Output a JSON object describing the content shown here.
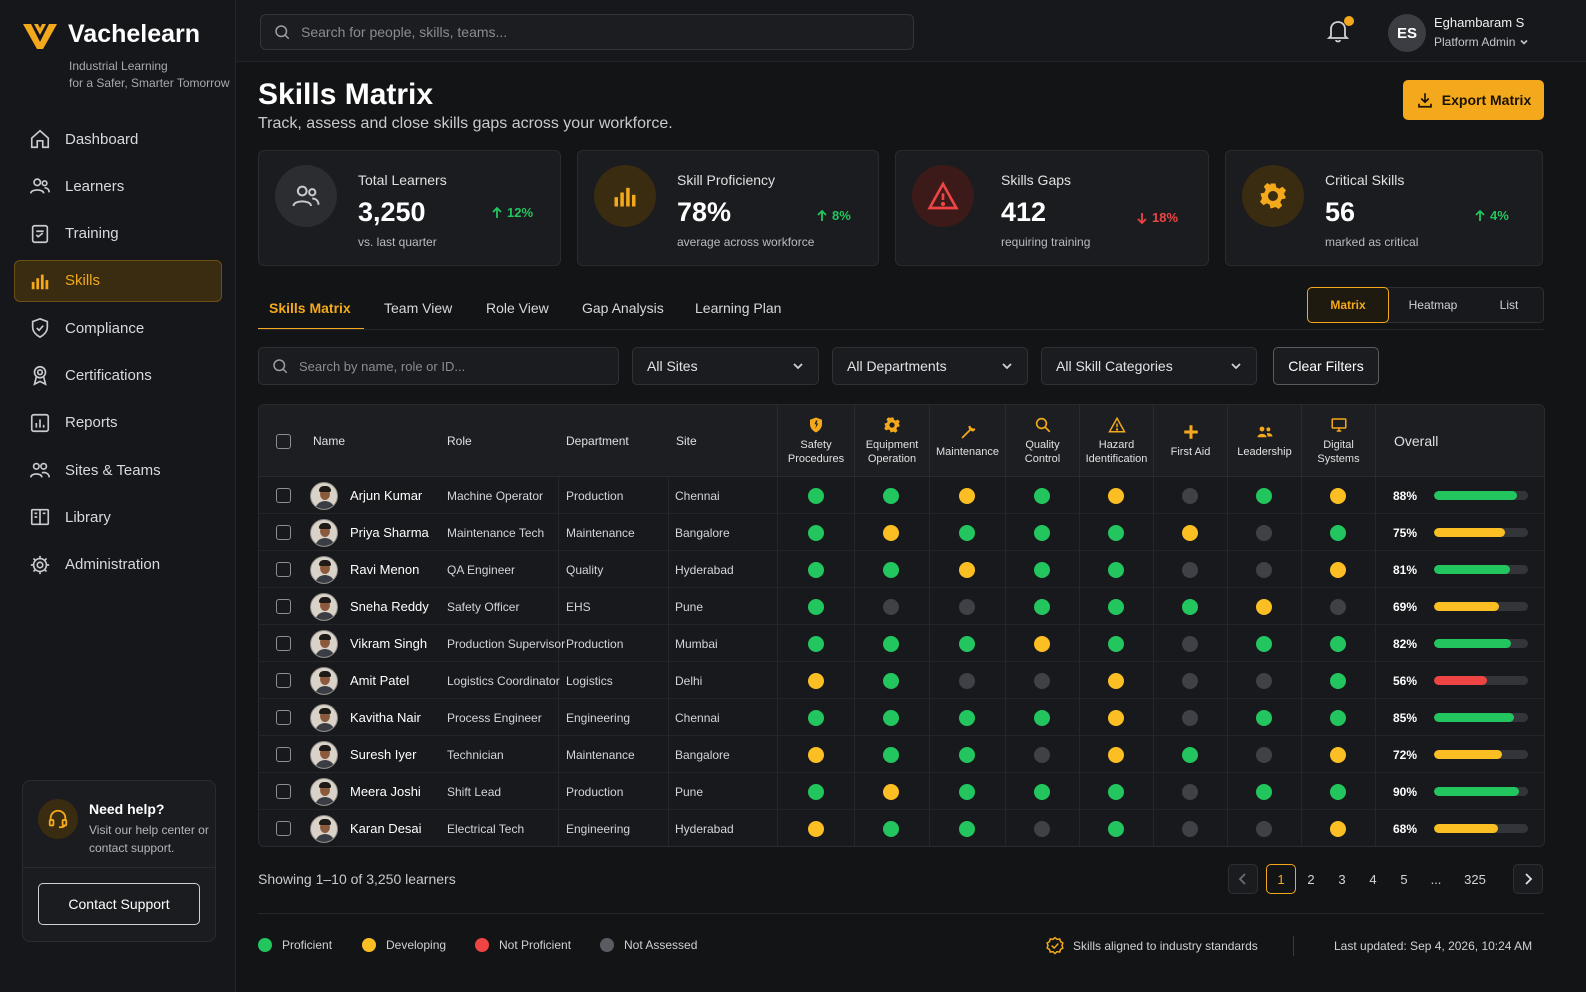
{
  "brand": {
    "name": "Vachelearn",
    "tagline_1": "Industrial Learning",
    "tagline_2": "for a Safer, Smarter Tomorrow",
    "accent": "#f3a91b"
  },
  "nav": [
    {
      "label": "Dashboard",
      "icon": "home-icon"
    },
    {
      "label": "Learners",
      "icon": "users-icon"
    },
    {
      "label": "Training",
      "icon": "clipboard-icon"
    },
    {
      "label": "Skills",
      "icon": "bar-chart-icon",
      "active": true
    },
    {
      "label": "Compliance",
      "icon": "shield-check-icon"
    },
    {
      "label": "Certifications",
      "icon": "award-icon"
    },
    {
      "label": "Reports",
      "icon": "report-icon"
    },
    {
      "label": "Sites & Teams",
      "icon": "team-icon"
    },
    {
      "label": "Library",
      "icon": "book-icon"
    },
    {
      "label": "Administration",
      "icon": "gear-icon"
    }
  ],
  "help": {
    "title": "Need help?",
    "text": "Visit our help center or contact support.",
    "button": "Contact Support"
  },
  "topbar": {
    "search_placeholder": "Search for people, skills, teams...",
    "user_initials": "ES",
    "user_name": "Eghambaram S",
    "user_role": "Platform Admin"
  },
  "page": {
    "title": "Skills Matrix",
    "subtitle": "Track, assess and close skills gaps across your workforce.",
    "export_label": "Export Matrix"
  },
  "stats": [
    {
      "label": "Total Learners",
      "value": "3,250",
      "trend": "12%",
      "direction": "up",
      "note": "vs. last quarter",
      "icon": "users-icon"
    },
    {
      "label": "Skill Proficiency",
      "value": "78%",
      "trend": "8%",
      "direction": "up",
      "note": "average across workforce",
      "icon": "bar-chart-icon"
    },
    {
      "label": "Skills Gaps",
      "value": "412",
      "trend": "18%",
      "direction": "down",
      "note": "requiring training",
      "icon": "warning-icon"
    },
    {
      "label": "Critical Skills",
      "value": "56",
      "trend": "4%",
      "direction": "up",
      "note": "marked as critical",
      "icon": "gear-icon"
    }
  ],
  "tabs": [
    "Skills Matrix",
    "Team View",
    "Role View",
    "Gap Analysis",
    "Learning Plan"
  ],
  "views": [
    "Matrix",
    "Heatmap",
    "List"
  ],
  "filters": {
    "search_placeholder": "Search by name, role or ID...",
    "sites": "All Sites",
    "departments": "All Departments",
    "categories": "All Skill Categories",
    "clear": "Clear Filters"
  },
  "table": {
    "columns": {
      "name": "Name",
      "role": "Role",
      "department": "Department",
      "site": "Site",
      "overall": "Overall"
    },
    "skills": [
      {
        "label_1": "Safety",
        "label_2": "Procedures",
        "icon": "shield-icon"
      },
      {
        "label_1": "Equipment",
        "label_2": "Operation",
        "icon": "gear-icon"
      },
      {
        "label_1": "Maintenance",
        "label_2": "",
        "icon": "wrench-icon"
      },
      {
        "label_1": "Quality",
        "label_2": "Control",
        "icon": "search-icon"
      },
      {
        "label_1": "Hazard",
        "label_2": "Identification",
        "icon": "warning-icon"
      },
      {
        "label_1": "First Aid",
        "label_2": "",
        "icon": "plus-icon"
      },
      {
        "label_1": "Leadership",
        "label_2": "",
        "icon": "team-icon"
      },
      {
        "label_1": "Digital",
        "label_2": "Systems",
        "icon": "monitor-icon"
      }
    ],
    "rows": [
      {
        "name": "Arjun Kumar",
        "role": "Machine Operator",
        "department": "Production",
        "site": "Chennai",
        "skills": [
          "p",
          "p",
          "d",
          "p",
          "d",
          "a",
          "p",
          "d"
        ],
        "overall": "88%",
        "overall_value": 0.88
      },
      {
        "name": "Priya Sharma",
        "role": "Maintenance Tech",
        "department": "Maintenance",
        "site": "Bangalore",
        "skills": [
          "p",
          "d",
          "p",
          "p",
          "p",
          "d",
          "a",
          "p"
        ],
        "overall": "75%",
        "overall_value": 0.75
      },
      {
        "name": "Ravi Menon",
        "role": "QA Engineer",
        "department": "Quality",
        "site": "Hyderabad",
        "skills": [
          "p",
          "p",
          "d",
          "p",
          "p",
          "a",
          "a",
          "d"
        ],
        "overall": "81%",
        "overall_value": 0.81
      },
      {
        "name": "Sneha Reddy",
        "role": "Safety Officer",
        "department": "EHS",
        "site": "Pune",
        "skills": [
          "p",
          "a",
          "a",
          "p",
          "p",
          "p",
          "d",
          "a"
        ],
        "overall": "69%",
        "overall_value": 0.69
      },
      {
        "name": "Vikram Singh",
        "role": "Production Supervisor",
        "department": "Production",
        "site": "Mumbai",
        "skills": [
          "p",
          "p",
          "p",
          "d",
          "p",
          "a",
          "p",
          "p"
        ],
        "overall": "82%",
        "overall_value": 0.82
      },
      {
        "name": "Amit Patel",
        "role": "Logistics Coordinator",
        "department": "Logistics",
        "site": "Delhi",
        "skills": [
          "d",
          "p",
          "a",
          "a",
          "d",
          "a",
          "a",
          "p"
        ],
        "overall": "56%",
        "overall_value": 0.56
      },
      {
        "name": "Kavitha Nair",
        "role": "Process Engineer",
        "department": "Engineering",
        "site": "Chennai",
        "skills": [
          "p",
          "p",
          "p",
          "p",
          "d",
          "a",
          "p",
          "p"
        ],
        "overall": "85%",
        "overall_value": 0.85
      },
      {
        "name": "Suresh Iyer",
        "role": "Technician",
        "department": "Maintenance",
        "site": "Bangalore",
        "skills": [
          "d",
          "p",
          "p",
          "a",
          "d",
          "p",
          "a",
          "d"
        ],
        "overall": "72%",
        "overall_value": 0.72
      },
      {
        "name": "Meera Joshi",
        "role": "Shift Lead",
        "department": "Production",
        "site": "Pune",
        "skills": [
          "p",
          "d",
          "p",
          "p",
          "p",
          "a",
          "p",
          "p"
        ],
        "overall": "90%",
        "overall_value": 0.9
      },
      {
        "name": "Karan Desai",
        "role": "Electrical Tech",
        "department": "Engineering",
        "site": "Hyderabad",
        "skills": [
          "d",
          "p",
          "p",
          "a",
          "p",
          "a",
          "a",
          "d"
        ],
        "overall": "68%",
        "overall_value": 0.68
      }
    ]
  },
  "status_colors": {
    "p": "#22c55e",
    "d": "#fbbf24",
    "n": "#ef4444",
    "a": "#3f4146"
  },
  "pagination": {
    "showing": "Showing 1–10 of 3,250 learners",
    "pages": [
      "1",
      "2",
      "3",
      "4",
      "5",
      "...",
      "325"
    ],
    "current": "1"
  },
  "legend": [
    "Proficient",
    "Developing",
    "Not Proficient",
    "Not Assessed"
  ],
  "footer": {
    "aligned": "Skills aligned to industry standards",
    "updated": "Last updated: Sep 4, 2026, 10:24 AM"
  }
}
